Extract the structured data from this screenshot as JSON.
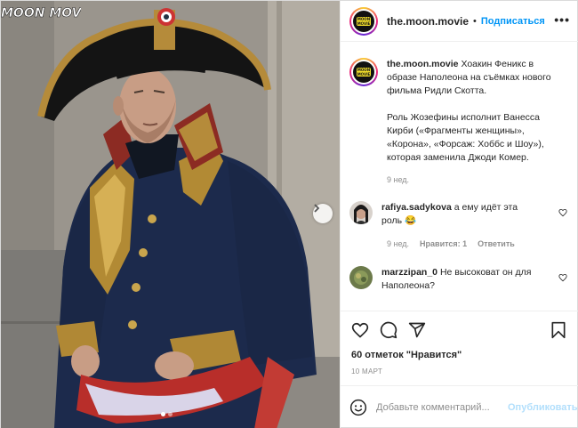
{
  "media": {
    "watermark": "MOON MOVIE",
    "carousel_dots": 2,
    "active_dot": 0
  },
  "header": {
    "username": "the.moon.movie",
    "separator": "•",
    "follow_label": "Подписаться",
    "more_label": "•••",
    "avatar_logo": "MOON\nMOVIE"
  },
  "caption": {
    "username": "the.moon.movie",
    "text_1": "Хоакин Феникс в образе Наполеона на съёмках нового фильма Ридли Скотта.",
    "text_2": "Роль Жозефины исполнит Ванесса Кирби («Фрагменты женщины», «Корона», «Форсаж: Хоббс и Шоу»), которая заменила Джоди Комер.",
    "time": "9 нед."
  },
  "comments": [
    {
      "username": "rafiya.sadykova",
      "text": "а ему идёт эта роль 😂",
      "time": "9 нед.",
      "likes": "Нравится: 1",
      "reply": "Ответить"
    },
    {
      "username": "marzzipan_0",
      "text": "Не высоковат он для Наполеона?"
    }
  ],
  "likes_count": "60 отметок \"Нравится\"",
  "date": "10 МАРТ",
  "add_comment": {
    "placeholder": "Добавьте комментарий...",
    "publish_label": "Опубликовать"
  },
  "colors": {
    "accent": "#0095f6",
    "publish_disabled": "#b2dffc",
    "muted": "#8e8e8e",
    "border": "#efefef"
  }
}
